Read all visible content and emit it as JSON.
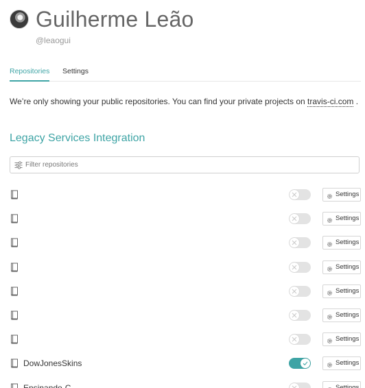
{
  "profile": {
    "name": "Guilherme Leão",
    "login": "@leaogui"
  },
  "tabs": [
    {
      "label": "Repositories",
      "active": true
    },
    {
      "label": "Settings",
      "active": false
    }
  ],
  "notice": {
    "text": "We’re only showing your public repositories. You can find your private projects on",
    "link_text": "travis-ci.com",
    "suffix": "."
  },
  "section_title": "Legacy Services Integration",
  "filter": {
    "placeholder": "Filter repositories",
    "value": "",
    "icon": "filter-sliders-icon"
  },
  "repositories": [
    {
      "name": "",
      "enabled": false,
      "settings_label": "Settings"
    },
    {
      "name": "",
      "enabled": false,
      "settings_label": "Settings"
    },
    {
      "name": "",
      "enabled": false,
      "settings_label": "Settings"
    },
    {
      "name": "",
      "enabled": false,
      "settings_label": "Settings"
    },
    {
      "name": "",
      "enabled": false,
      "settings_label": "Settings"
    },
    {
      "name": "",
      "enabled": false,
      "settings_label": "Settings"
    },
    {
      "name": "",
      "enabled": false,
      "settings_label": "Settings"
    },
    {
      "name": "DowJonesSkins",
      "enabled": true,
      "settings_label": "Settings"
    },
    {
      "name": "Ensinando-C",
      "enabled": false,
      "settings_label": "Settings"
    }
  ],
  "colors": {
    "accent": "#3ea4a5",
    "toggle_off": "#e3e3e3",
    "text": "#333333",
    "muted": "#999999"
  },
  "icons": {
    "repo": "repo-book-icon",
    "settings": "gear-icon",
    "toggle_off": "x-icon",
    "toggle_on": "check-icon"
  }
}
